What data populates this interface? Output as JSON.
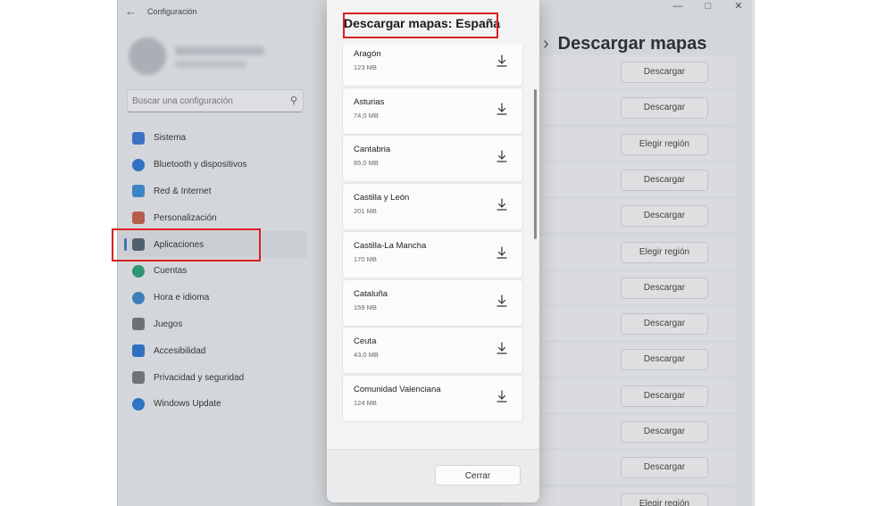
{
  "window": {
    "title": "Configuración",
    "back_icon": "back-arrow-icon",
    "controls": [
      "minimize-icon",
      "maximize-icon",
      "close-icon"
    ]
  },
  "search": {
    "placeholder": "Buscar una configuración"
  },
  "sidebar": {
    "items": [
      {
        "label": "Sistema",
        "icon": "system-icon",
        "color": "#2d6fd6"
      },
      {
        "label": "Bluetooth y dispositivos",
        "icon": "bluetooth-icon",
        "color": "#1e6fd9"
      },
      {
        "label": "Red & Internet",
        "icon": "network-icon",
        "color": "#2b88d8"
      },
      {
        "label": "Personalización",
        "icon": "brush-icon",
        "color": "#c8553d"
      },
      {
        "label": "Aplicaciones",
        "icon": "apps-icon",
        "color": "#4a5a6a",
        "selected": true
      },
      {
        "label": "Cuentas",
        "icon": "accounts-icon",
        "color": "#1b9e6e"
      },
      {
        "label": "Hora e idioma",
        "icon": "time-language-icon",
        "color": "#2c7fc8"
      },
      {
        "label": "Juegos",
        "icon": "games-icon",
        "color": "#6b6f74"
      },
      {
        "label": "Accesibilidad",
        "icon": "accessibility-icon",
        "color": "#1c6fd0"
      },
      {
        "label": "Privacidad y seguridad",
        "icon": "shield-icon",
        "color": "#6d7278"
      },
      {
        "label": "Windows Update",
        "icon": "windows-update-icon",
        "color": "#1d74d6"
      }
    ]
  },
  "main": {
    "title": "Descargar mapas",
    "rows": [
      "Descargar",
      "Descargar",
      "Elegir región",
      "Descargar",
      "Descargar",
      "Elegir región",
      "Descargar",
      "Descargar",
      "Descargar",
      "Descargar",
      "Descargar",
      "Descargar",
      "Elegir región"
    ]
  },
  "dialog": {
    "title": "Descargar mapas: España",
    "regions": [
      {
        "name": "Aragón",
        "size": "123 MB"
      },
      {
        "name": "Asturias",
        "size": "74,0 MB"
      },
      {
        "name": "Cantabria",
        "size": "65,0 MB"
      },
      {
        "name": "Castilla y León",
        "size": "201 MB"
      },
      {
        "name": "Castilla-La Mancha",
        "size": "170 MB"
      },
      {
        "name": "Cataluña",
        "size": "159 MB"
      },
      {
        "name": "Ceuta",
        "size": "43,0 MB"
      },
      {
        "name": "Comunidad Valenciana",
        "size": "124 MB"
      }
    ],
    "close_label": "Cerrar"
  },
  "colors": {
    "accent": "#3b6dc5",
    "highlight": "#d8201f"
  }
}
